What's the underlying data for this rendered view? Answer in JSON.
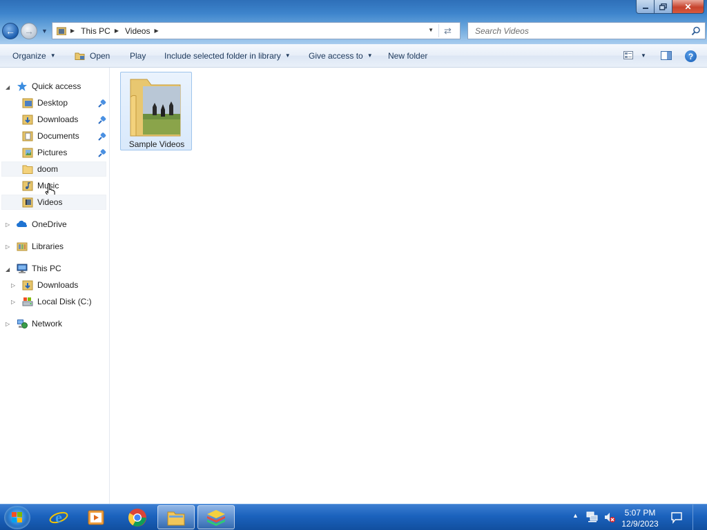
{
  "window": {
    "address": {
      "crumbs": [
        "This PC",
        "Videos"
      ]
    },
    "search": {
      "placeholder": "Search Videos"
    }
  },
  "toolbar": {
    "organize": "Organize",
    "open": "Open",
    "play": "Play",
    "include": "Include selected folder in library",
    "give_access": "Give access to",
    "new_folder": "New folder"
  },
  "nav": {
    "quick_access": "Quick access",
    "quick_items": [
      "Desktop",
      "Downloads",
      "Documents",
      "Pictures",
      "doom",
      "Music",
      "Videos"
    ],
    "onedrive": "OneDrive",
    "libraries": "Libraries",
    "this_pc": "This PC",
    "pc_items": [
      "Downloads",
      "Local Disk (C:)"
    ],
    "network": "Network"
  },
  "content": {
    "items": [
      {
        "name": "Sample Videos",
        "type": "folder",
        "selected": true
      }
    ]
  },
  "taskbar": {
    "pinned": [
      "internet-explorer",
      "windows-media-player",
      "chrome",
      "file-explorer",
      "bluestacks"
    ],
    "clock": {
      "time": "5:07 PM",
      "date": "12/9/2023"
    }
  },
  "colors": {
    "accent": "#1d5fb0",
    "taskbar": "#1b62bd",
    "selection": "#d9e9fb"
  }
}
